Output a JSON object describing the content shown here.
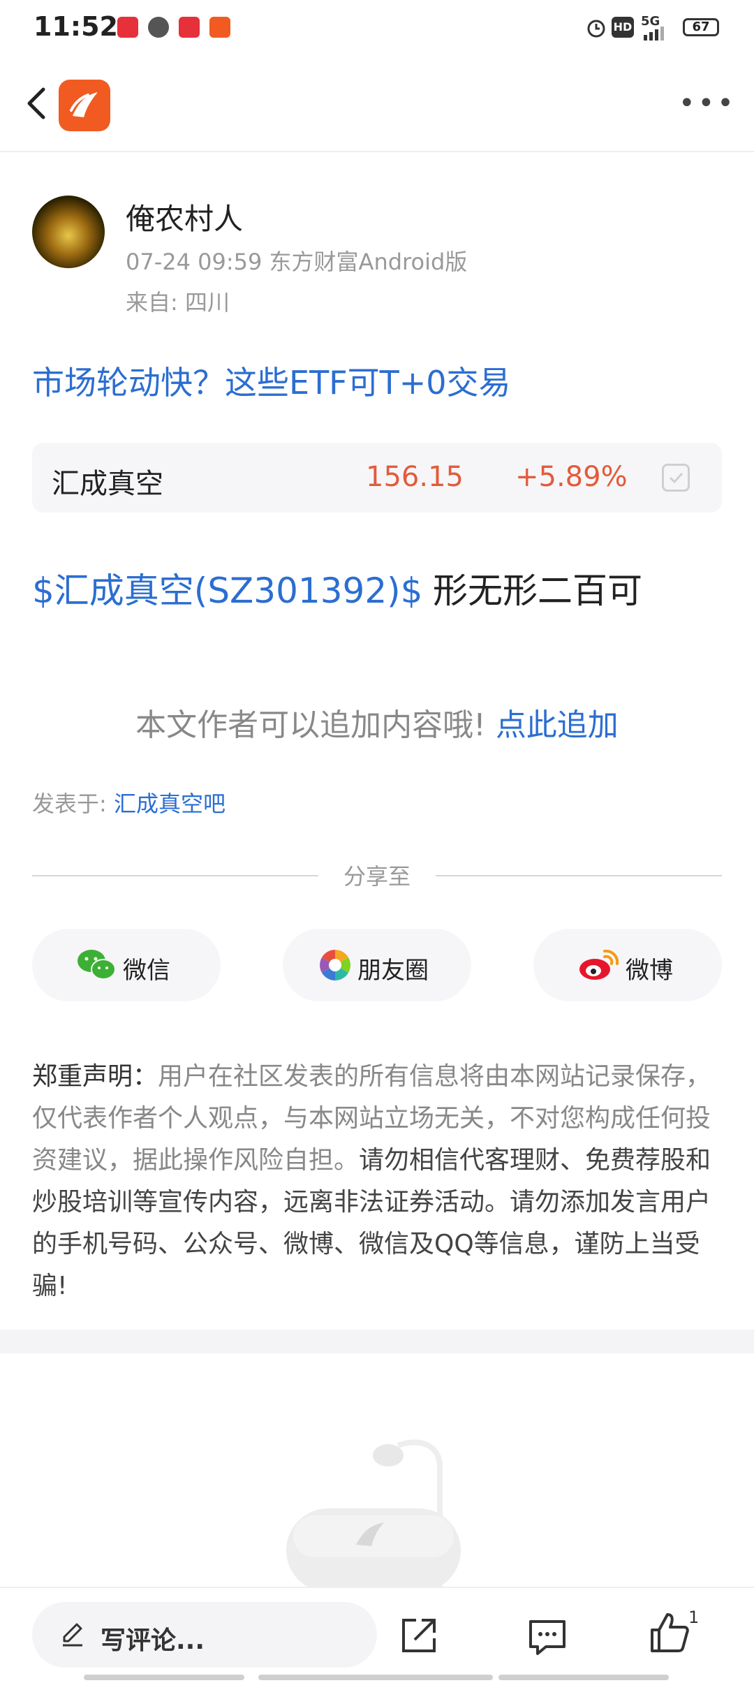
{
  "status_bar": {
    "time": "11:52",
    "network": "5G",
    "hd_label": "HD",
    "battery": "67"
  },
  "post": {
    "author": "俺农村人",
    "meta": "07-24 09:59 东方财富Android版",
    "location": "来自: 四川",
    "title": "市场轮动快？这些ETF可T+0交易",
    "stock": {
      "name": "汇成真空",
      "price": "156.15",
      "change": "+5.89%"
    },
    "content_tag": "$汇成真空(SZ301392)$",
    "content_text": "形无形二百可",
    "append_prompt": "本文作者可以追加内容哦!",
    "append_link": "点此追加",
    "posted_in_label": "发表于:",
    "posted_in_link": "汇成真空吧"
  },
  "share": {
    "label": "分享至",
    "wechat": "微信",
    "moments": "朋友圈",
    "weibo": "微博"
  },
  "disclaimer": {
    "lead": "郑重声明：",
    "grey_text": "用户在社区发表的所有信息将由本网站记录保存，仅代表作者个人观点，与本网站立场无关，不对您构成任何投资建议，据此操作风险自担。",
    "dark_text": "请勿相信代客理财、免费荐股和炒股培训等宣传内容，远离非法证券活动。请勿添加发言用户的手机号码、公众号、微博、微信及QQ等信息，谨防上当受骗!"
  },
  "bottom_bar": {
    "comment_placeholder": "写评论...",
    "like_count": "1"
  },
  "colors": {
    "brand": "#f15b22",
    "link": "#2b6ed1",
    "up": "#e35b3b"
  }
}
